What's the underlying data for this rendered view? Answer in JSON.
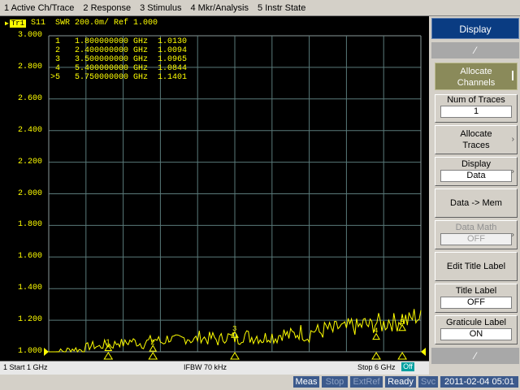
{
  "menu": [
    "1 Active Ch/Trace",
    "2 Response",
    "3 Stimulus",
    "4 Mkr/Analysis",
    "5 Instr State"
  ],
  "trace_header": {
    "tr_label": "Tr1",
    "text": "S11  SWR 200.0m/ Ref 1.000"
  },
  "markers": [
    {
      "label": " 1",
      "freq": "1.800000000 GHz",
      "value": "1.0130"
    },
    {
      "label": " 2",
      "freq": "2.400000000 GHz",
      "value": "1.0094"
    },
    {
      "label": " 3",
      "freq": "3.500000000 GHz",
      "value": "1.0965"
    },
    {
      "label": " 4",
      "freq": "5.400000000 GHz",
      "value": "1.0844"
    },
    {
      "label": ">5",
      "freq": "5.750000000 GHz",
      "value": "1.1401"
    }
  ],
  "status": {
    "start": "1  Start 1 GHz",
    "ifbw": "IFBW 70 kHz",
    "stop": "Stop 6 GHz",
    "off": "Off"
  },
  "bottom_status": {
    "meas": "Meas",
    "stop": "Stop",
    "extref": "ExtRef",
    "ready": "Ready",
    "svc": "Svc",
    "datetime": "2011-02-04 05:01"
  },
  "softkeys": {
    "title": "Display",
    "allocate_channels": "Allocate\nChannels",
    "num_traces_label": "Num of Traces",
    "num_traces_value": "1",
    "allocate_traces": "Allocate\nTraces",
    "display_label": "Display",
    "display_value": "Data",
    "data_to_mem": "Data -> Mem",
    "data_math_label": "Data Math",
    "data_math_value": "OFF",
    "edit_title_label": "Edit Title Label",
    "title_label": "Title Label",
    "title_label_value": "OFF",
    "graticule_label": "Graticule Label",
    "graticule_label_value": "ON"
  },
  "colors": {
    "trace": "#ffff00",
    "grid": "#5a7a7a",
    "background": "#000000"
  },
  "chart_data": {
    "type": "line",
    "title": "S11  SWR 200.0m/ Ref 1.000",
    "x_range_ghz": [
      1,
      6
    ],
    "ylim": [
      1.0,
      3.0
    ],
    "y_ticks": [
      "3.000",
      "2.800",
      "2.600",
      "2.400",
      "2.200",
      "2.000",
      "1.800",
      "1.600",
      "1.400",
      "1.200",
      "1.000"
    ],
    "grid": true,
    "series": [
      {
        "values": [
          1.02,
          1.03,
          1.03,
          1.04,
          1.05,
          1.04,
          1.06,
          1.07,
          1.06,
          1.08,
          1.07,
          1.09,
          1.08,
          1.1,
          1.09,
          1.08,
          1.1,
          1.11,
          1.09,
          1.12,
          1.1,
          1.11,
          1.12,
          1.1,
          1.13,
          1.11,
          1.12,
          1.1,
          1.13,
          1.12,
          1.11,
          1.14,
          1.12,
          1.13,
          1.11,
          1.14,
          1.12,
          1.15,
          1.13,
          1.14,
          1.16,
          1.13,
          1.17,
          1.15,
          1.18,
          1.16,
          1.19,
          1.17,
          1.2,
          1.18,
          1.21,
          1.19,
          1.22,
          1.2,
          1.23,
          1.21,
          1.25,
          1.22,
          1.26,
          1.24
        ],
        "x_start_ghz": 1,
        "x_stop_ghz": 6
      }
    ],
    "marker_points": [
      {
        "x": 1.8,
        "y": 1.013
      },
      {
        "x": 2.4,
        "y": 1.0094
      },
      {
        "x": 3.5,
        "y": 1.0965
      },
      {
        "x": 5.4,
        "y": 1.0844
      },
      {
        "x": 5.75,
        "y": 1.1401
      }
    ]
  }
}
